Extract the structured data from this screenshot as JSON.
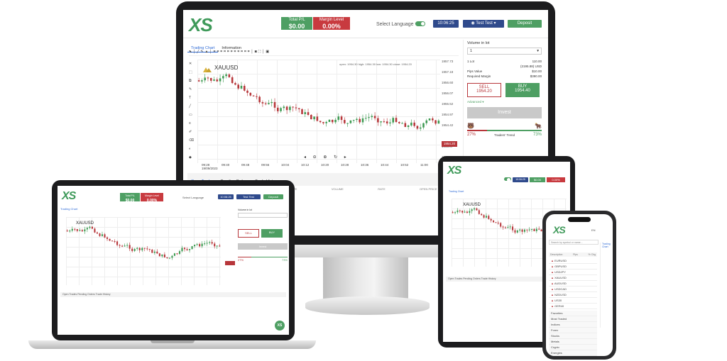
{
  "brand": {
    "logo": "XS",
    "accent": "#4e9f63",
    "sell_color": "#b7363a",
    "nav_blue": "#2f4a8c"
  },
  "header": {
    "total_pl_label": "Total P/L",
    "total_pl_value": "$0.00",
    "margin_label": "Margin Level",
    "margin_value": "0.00%",
    "language": "Select Language",
    "time": "10:06:25",
    "user": "Test Test",
    "deposit": "Deposit"
  },
  "tabs": {
    "chart": "Trading Chart",
    "info": "Information"
  },
  "chart": {
    "symbol": "XAUUSD",
    "ohlc": "open: 1954.30 high: 1954.30 low: 1954.30 close: 1954.20",
    "current_price": "1954.20",
    "price_ticks": [
      "1957.73",
      "1957.18",
      "1956.60",
      "1956.07",
      "1955.52",
      "1954.97",
      "1954.42",
      "1954.20",
      "1953.87",
      "1953.30"
    ],
    "time_ticks": [
      "09:28\n19/09/2023",
      "09:40",
      "09:48",
      "09:56",
      "10:04",
      "10:12",
      "10:20",
      "10:28",
      "10:36",
      "10:44",
      "10:52",
      "11:00"
    ]
  },
  "side": {
    "volume_label": "Volume in lot",
    "volume_value": "1",
    "rows": [
      {
        "k": "1 Lot",
        "v": "110.00"
      },
      {
        "k": "",
        "v": "(2195.88) USD"
      },
      {
        "k": "Pips Value",
        "v": "$10.00"
      },
      {
        "k": "Required Margin",
        "v": "$390.00"
      }
    ],
    "sell_label": "SELL",
    "sell_price": "1954.20",
    "buy_label": "BUY",
    "buy_price": "1954.40",
    "advanced": "Advanced",
    "invest": "Invest",
    "sell_pct": "27%",
    "traders_trend": "Traders' Trend",
    "buy_pct": "73%"
  },
  "bottom_tabs": [
    "Open Trades",
    "Pending Orders",
    "Trade History"
  ],
  "columns": [
    "TYPE",
    "VOLUME",
    "RATE",
    "OPEN PRICE",
    "CURRENT PRICE",
    "STOP LOSS"
  ],
  "laptop": {
    "sell_btn": "SELL",
    "buy_btn": "BUY",
    "fab": "XS"
  },
  "phone": {
    "lang": "EN",
    "search": "Search by symbol or name...",
    "cols": [
      "Description",
      "Pips",
      "% Chg"
    ],
    "rows": [
      "EURUSD",
      "GBPUSD",
      "USDJPY",
      "XAUUSD",
      "AUDUSD",
      "USDCAD",
      "NZDUSD",
      "US30",
      "GER40"
    ],
    "menu": [
      "Favorites",
      "Most Traded",
      "Indices",
      "Forex",
      "Stocks",
      "Metals",
      "Crypto",
      "Energies"
    ]
  }
}
